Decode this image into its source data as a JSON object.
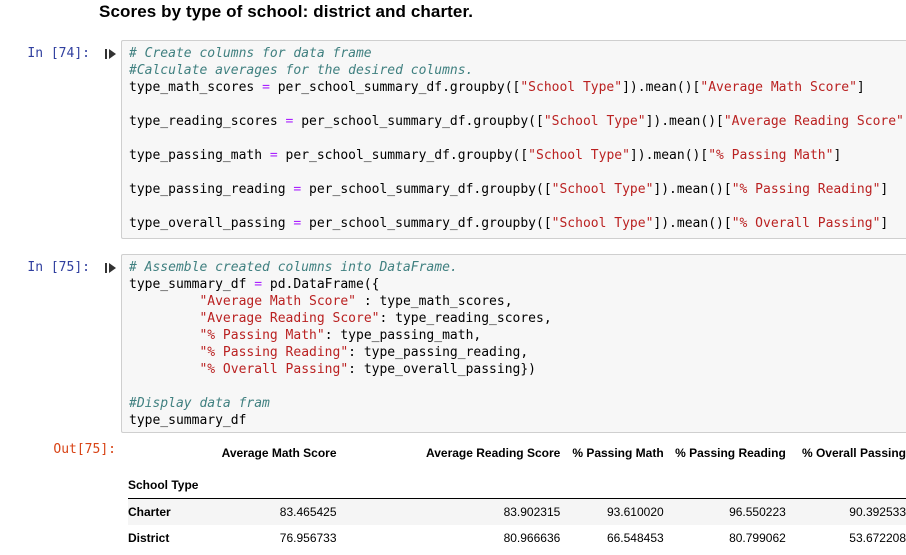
{
  "heading": "Scores by type of school: district and charter.",
  "cells": [
    {
      "prompt": "In [74]:",
      "lines": [
        [
          {
            "t": "cm",
            "v": "# Create columns for data frame"
          }
        ],
        [
          {
            "t": "cm",
            "v": "#Calculate averages for the desired columns."
          }
        ],
        [
          {
            "t": "n",
            "v": "type_math_scores "
          },
          {
            "t": "op",
            "v": "="
          },
          {
            "t": "n",
            "v": " per_school_summary_df.groupby(["
          },
          {
            "t": "st",
            "v": "\"School Type\""
          },
          {
            "t": "n",
            "v": "]).mean()["
          },
          {
            "t": "st",
            "v": "\"Average Math Score\""
          },
          {
            "t": "n",
            "v": "]"
          }
        ],
        [],
        [
          {
            "t": "n",
            "v": "type_reading_scores "
          },
          {
            "t": "op",
            "v": "="
          },
          {
            "t": "n",
            "v": " per_school_summary_df.groupby(["
          },
          {
            "t": "st",
            "v": "\"School Type\""
          },
          {
            "t": "n",
            "v": "]).mean()["
          },
          {
            "t": "st",
            "v": "\"Average Reading Score\""
          },
          {
            "t": "n",
            "v": "]"
          }
        ],
        [],
        [
          {
            "t": "n",
            "v": "type_passing_math "
          },
          {
            "t": "op",
            "v": "="
          },
          {
            "t": "n",
            "v": " per_school_summary_df.groupby(["
          },
          {
            "t": "st",
            "v": "\"School Type\""
          },
          {
            "t": "n",
            "v": "]).mean()["
          },
          {
            "t": "st",
            "v": "\"% Passing Math\""
          },
          {
            "t": "n",
            "v": "]"
          }
        ],
        [],
        [
          {
            "t": "n",
            "v": "type_passing_reading "
          },
          {
            "t": "op",
            "v": "="
          },
          {
            "t": "n",
            "v": " per_school_summary_df.groupby(["
          },
          {
            "t": "st",
            "v": "\"School Type\""
          },
          {
            "t": "n",
            "v": "]).mean()["
          },
          {
            "t": "st",
            "v": "\"% Passing Reading\""
          },
          {
            "t": "n",
            "v": "]"
          }
        ],
        [],
        [
          {
            "t": "n",
            "v": "type_overall_passing "
          },
          {
            "t": "op",
            "v": "="
          },
          {
            "t": "n",
            "v": " per_school_summary_df.groupby(["
          },
          {
            "t": "st",
            "v": "\"School Type\""
          },
          {
            "t": "n",
            "v": "]).mean()["
          },
          {
            "t": "st",
            "v": "\"% Overall Passing\""
          },
          {
            "t": "n",
            "v": "]"
          }
        ]
      ]
    },
    {
      "prompt": "In [75]:",
      "lines": [
        [
          {
            "t": "cm",
            "v": "# Assemble created columns into DataFrame."
          }
        ],
        [
          {
            "t": "n",
            "v": "type_summary_df "
          },
          {
            "t": "op",
            "v": "="
          },
          {
            "t": "n",
            "v": " pd.DataFrame({"
          }
        ],
        [
          {
            "t": "n",
            "v": "         "
          },
          {
            "t": "st",
            "v": "\"Average Math Score\""
          },
          {
            "t": "n",
            "v": " : type_math_scores,"
          }
        ],
        [
          {
            "t": "n",
            "v": "         "
          },
          {
            "t": "st",
            "v": "\"Average Reading Score\""
          },
          {
            "t": "n",
            "v": ": type_reading_scores,"
          }
        ],
        [
          {
            "t": "n",
            "v": "         "
          },
          {
            "t": "st",
            "v": "\"% Passing Math\""
          },
          {
            "t": "n",
            "v": ": type_passing_math,"
          }
        ],
        [
          {
            "t": "n",
            "v": "         "
          },
          {
            "t": "st",
            "v": "\"% Passing Reading\""
          },
          {
            "t": "n",
            "v": ": type_passing_reading,"
          }
        ],
        [
          {
            "t": "n",
            "v": "         "
          },
          {
            "t": "st",
            "v": "\"% Overall Passing\""
          },
          {
            "t": "n",
            "v": ": type_overall_passing})"
          }
        ],
        [],
        [
          {
            "t": "cm",
            "v": "#Display data fram"
          }
        ],
        [
          {
            "t": "n",
            "v": "type_summary_df"
          }
        ]
      ]
    }
  ],
  "output": {
    "prompt": "Out[75]:",
    "columns": [
      "Average Math Score",
      "Average Reading Score",
      "% Passing Math",
      "% Passing Reading",
      "% Overall Passing"
    ],
    "index_name": "School Type",
    "rows": [
      {
        "index": "Charter",
        "values": [
          "83.465425",
          "83.902315",
          "93.610020",
          "96.550223",
          "90.392533"
        ]
      },
      {
        "index": "District",
        "values": [
          "76.956733",
          "80.966636",
          "66.548453",
          "80.799062",
          "53.672208"
        ]
      }
    ]
  }
}
